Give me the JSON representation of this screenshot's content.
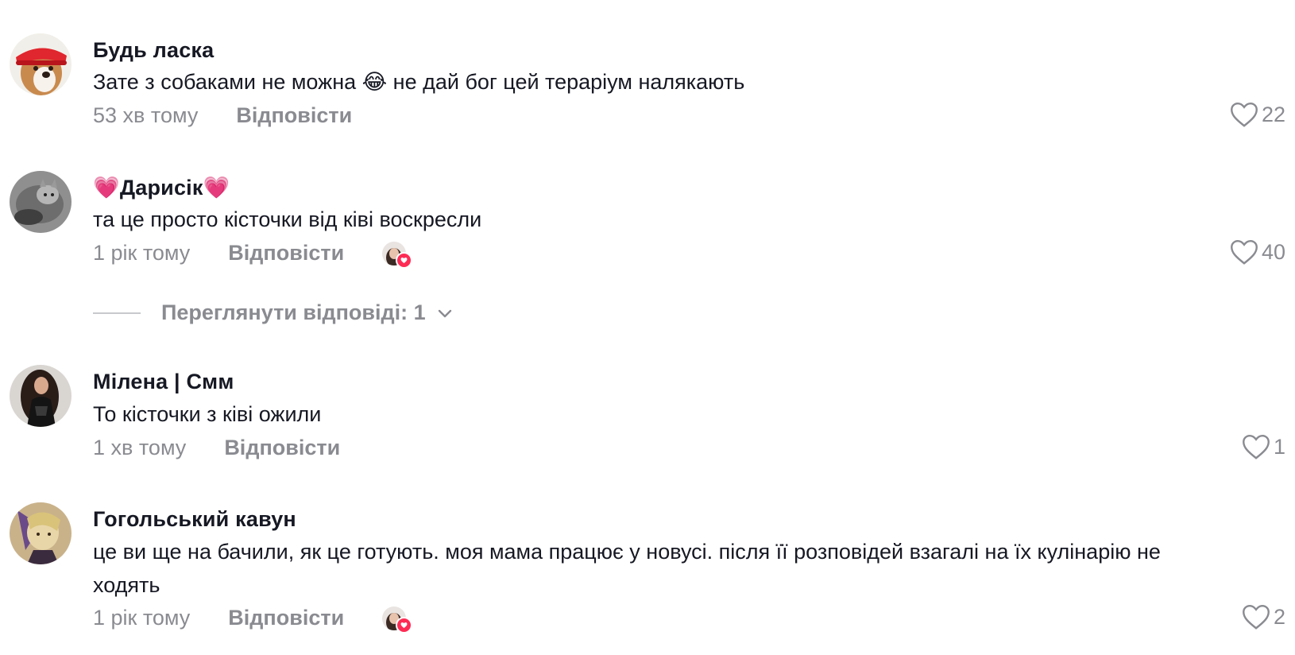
{
  "comments": [
    {
      "username": "Будь ласка",
      "text": "Зате з собаками не можна 😂 не дай бог цей тераріум налякають",
      "time": "53 хв тому",
      "reply_label": "Відповісти",
      "likes": "22",
      "avatar_icon": "corgi-avatar",
      "creator_liked": false
    },
    {
      "username": "💗Дарисік💗",
      "text": "та це просто кісточки від ківі воскресли",
      "time": "1 рік тому",
      "reply_label": "Відповісти",
      "likes": "40",
      "avatar_icon": "cat-avatar",
      "creator_liked": true,
      "view_replies": "Переглянути відповіді: 1"
    },
    {
      "username": "Мілена | Смм",
      "text": "То кісточки з ківі ожили",
      "time": "1 хв тому",
      "reply_label": "Відповісти",
      "likes": "1",
      "avatar_icon": "woman-avatar",
      "creator_liked": false
    },
    {
      "username": "Гогольський кавун",
      "text": "це ви ще на бачили, як це готують. моя мама працює у новусі. після її розповідей взагалі на їх кулінарію не ходять",
      "time": "1 рік тому",
      "reply_label": "Відповісти",
      "likes": "2",
      "avatar_icon": "anime-avatar",
      "creator_liked": true
    }
  ],
  "colors": {
    "text": "#161823",
    "muted": "#8a8b91",
    "accent": "#fe2c55"
  }
}
